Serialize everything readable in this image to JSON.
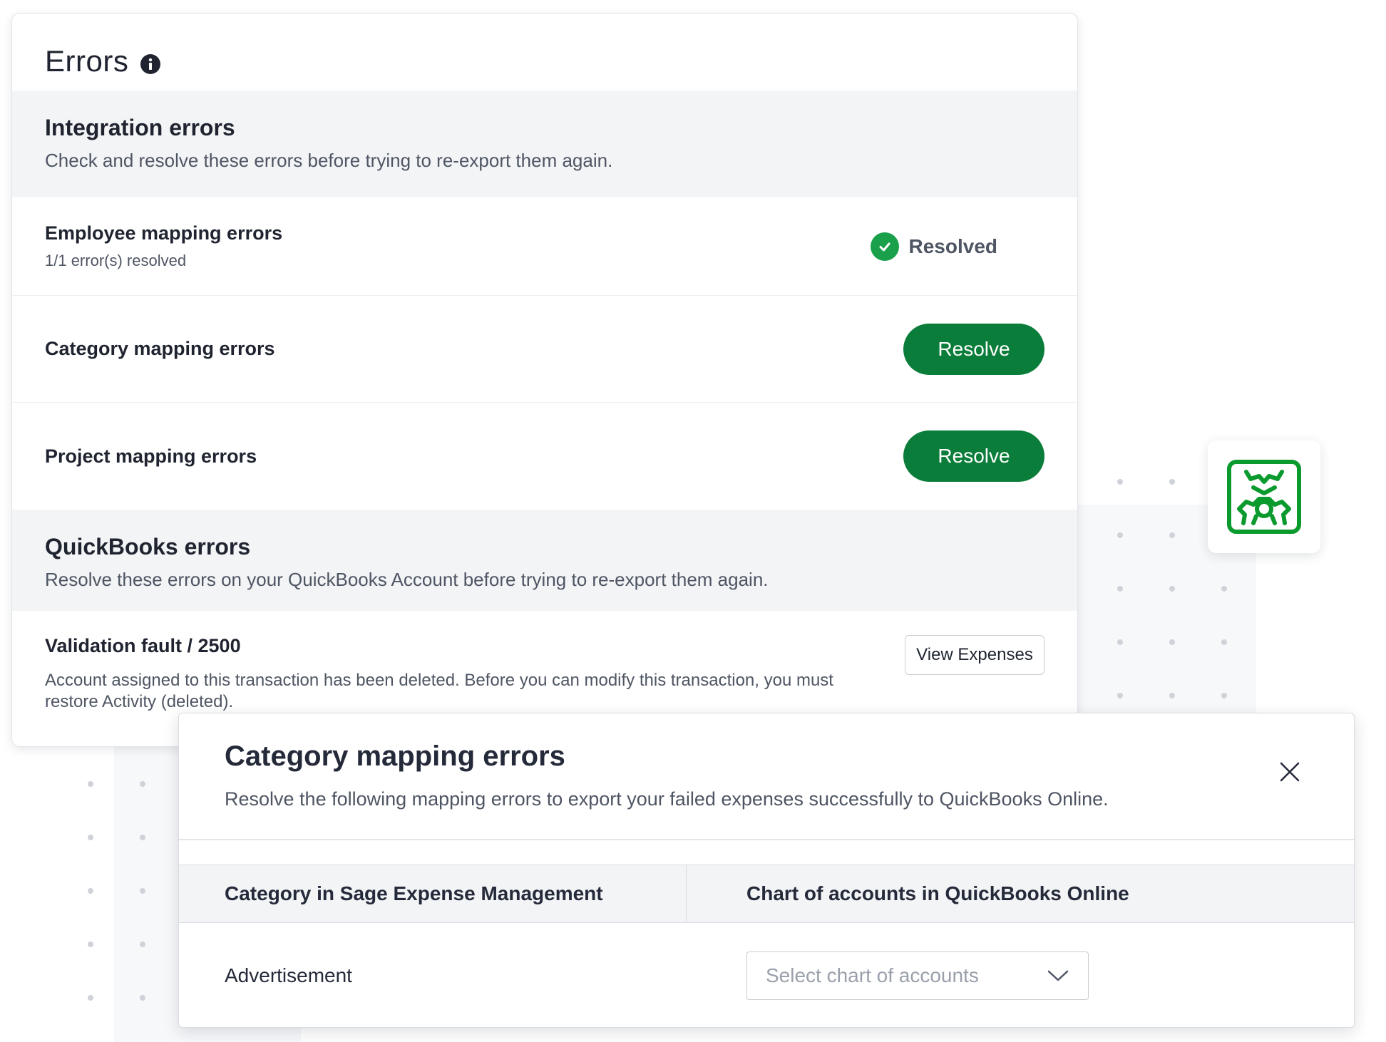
{
  "errors_card": {
    "title": "Errors",
    "integration": {
      "title": "Integration errors",
      "subtitle": "Check and resolve these errors before trying to re-export them again.",
      "rows": [
        {
          "title": "Employee mapping errors",
          "subtitle": "1/1 error(s) resolved",
          "status": "Resolved"
        },
        {
          "title": "Category mapping errors",
          "button": "Resolve"
        },
        {
          "title": "Project mapping errors",
          "button": "Resolve"
        }
      ]
    },
    "quickbooks": {
      "title": "QuickBooks errors",
      "subtitle": "Resolve these errors on your QuickBooks Account before trying to re-export them again.",
      "fault": {
        "title": "Validation fault / 2500",
        "description": "Account assigned to this transaction has been deleted. Before you can modify this transaction, you must restore Activity (deleted).",
        "button": "View Expenses"
      }
    }
  },
  "modal": {
    "title": "Category mapping errors",
    "subtitle": "Resolve the following mapping errors to export your failed expenses successfully to QuickBooks Online.",
    "columns": [
      "Category in Sage Expense Management",
      "Chart of accounts in QuickBooks Online"
    ],
    "rows": [
      {
        "category": "Advertisement",
        "select_placeholder": "Select chart of accounts"
      }
    ]
  },
  "icons": {
    "info": "info-icon",
    "check": "check-circle-icon",
    "close": "close-icon",
    "chevron": "chevron-down-icon",
    "integration": "integration-gear-icon"
  },
  "colors": {
    "primary_green": "#0b7d3a",
    "success_green": "#1aa04b",
    "band_gray": "#f3f4f6"
  }
}
